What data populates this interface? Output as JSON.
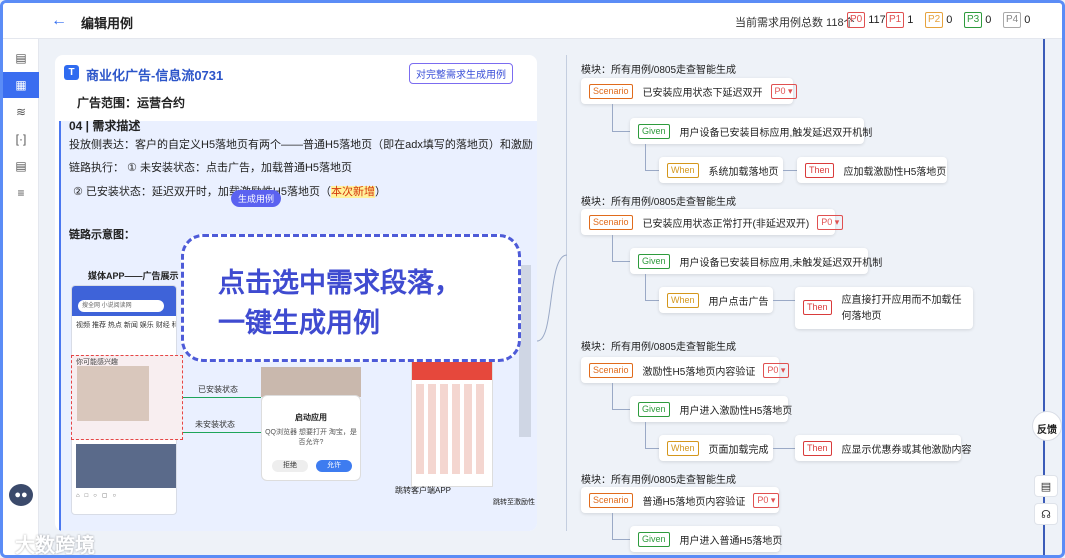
{
  "header": {
    "back_icon": "arrow-left-icon",
    "title": "编辑用例",
    "count_label": "当前需求用例总数 118个",
    "priorities": [
      {
        "tag": "P0",
        "count": "117",
        "color": "#e05050"
      },
      {
        "tag": "P1",
        "count": "1",
        "color": "#e05050"
      },
      {
        "tag": "P2",
        "count": "0",
        "color": "#e6a23c"
      },
      {
        "tag": "P3",
        "count": "0",
        "color": "#2d9b3c"
      },
      {
        "tag": "P4",
        "count": "0",
        "color": "#888888"
      }
    ]
  },
  "sidebar": {
    "icons": [
      "document-icon",
      "grid-icon",
      "pulse-icon",
      "bracket-icon",
      "list-icon",
      "sliders-icon"
    ],
    "assistant_icon": "robot-icon"
  },
  "doc": {
    "title": "商业化广告-信息流0731",
    "gen_all_button": "对完整需求生成用例",
    "ad_range": "广告范围：运营合约",
    "section_title": "04 | 需求描述",
    "para1": "投放侧表达：客户的自定义H5落地页有两个——普通H5落地页（即在adx填写的落地页）和激励",
    "para2": "链路执行： ① 未安装状态：点击广告，加载普通H5落地页",
    "para3_pre": "② 已安装状态：延迟双开时，加载激励性H5落地页（",
    "para3_hl": "本次新增",
    "para3_post": "）",
    "gen_chip": "生成用例",
    "diagram_label": "链路示意图：",
    "mock": {
      "title": "媒体APP——广告展示",
      "search_text": "搜全网  小说阅读网",
      "tabs": "视频  推荐  热点  新闻  娱乐  财经  科技",
      "feed_label": "你可能感兴趣",
      "installed_label": "已安装状态",
      "not_installed_label": "未安装状态",
      "dialog_title": "启动应用",
      "dialog_body": "QQ浏览器 想要打开 淘宝，是否允许?",
      "dialog_reject": "拒绝",
      "dialog_allow": "允许",
      "jump_client": "跳转客户端APP",
      "jump_reward": "跳转至激励性"
    }
  },
  "overlay": {
    "text": "点击选中需求段落，\n一键生成用例"
  },
  "cases": [
    {
      "module": "所有用例/0805走查智能生成",
      "scenario": "已安装应用状态下延迟双开",
      "priority": "P0",
      "given": "用户设备已安装目标应用,触发延迟双开机制",
      "when": "系统加载落地页",
      "then": "应加载激励性H5落地页"
    },
    {
      "module": "所有用例/0805走查智能生成",
      "scenario": "已安装应用状态正常打开(非延迟双开)",
      "priority": "P0",
      "given": "用户设备已安装目标应用,未触发延迟双开机制",
      "when": "用户点击广告",
      "then": "应直接打开应用而不加载任何落地页"
    },
    {
      "module": "所有用例/0805走查智能生成",
      "scenario": "激励性H5落地页内容验证",
      "priority": "P0",
      "given": "用户进入激励性H5落地页",
      "when": "页面加载完成",
      "then": "应显示优惠券或其他激励内容"
    },
    {
      "module": "所有用例/0805走查智能生成",
      "scenario": "普通H5落地页内容验证",
      "priority": "P0",
      "given": "用户进入普通H5落地页"
    }
  ],
  "labels": {
    "module_prefix": "模块：",
    "scenario": "Scenario",
    "given": "Given",
    "when": "When",
    "then": "Then",
    "feedback": "反馈",
    "watermark": "大数跨境"
  }
}
